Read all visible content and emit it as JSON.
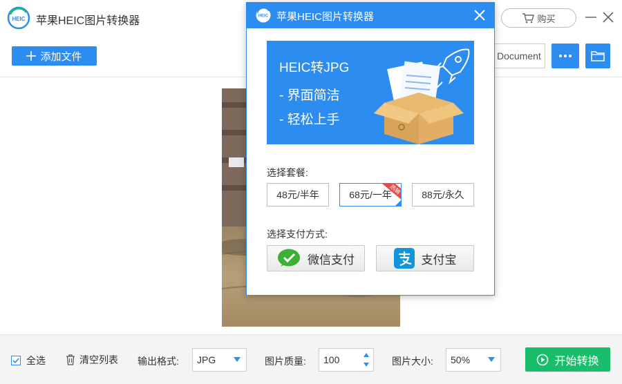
{
  "app": {
    "title": "苹果HEIC图片转换器",
    "logo_text": "HEIC",
    "buy_label": "购买"
  },
  "toolbar": {
    "add_file_label": "添加文件",
    "output_path": "Document"
  },
  "bottom": {
    "select_all_label": "全选",
    "select_all_checked": true,
    "clear_list_label": "清空列表",
    "output_format_label": "输出格式:",
    "output_format_value": "JPG",
    "quality_label": "图片质量:",
    "quality_value": "100",
    "size_label": "图片大小:",
    "size_value": "50%",
    "start_label": "开始转换"
  },
  "modal": {
    "title": "苹果HEIC图片转换器",
    "banner": {
      "line1": "HEIC转JPG",
      "line2": "- 界面简洁",
      "line3": "- 轻松上手"
    },
    "plan_label": "选择套餐:",
    "plans": [
      {
        "label": "48元/半年",
        "selected": false
      },
      {
        "label": "68元/一年",
        "selected": true,
        "badge": "热销"
      },
      {
        "label": "88元/永久",
        "selected": false
      }
    ],
    "payment_label": "选择支付方式:",
    "payments": {
      "wechat": "微信支付",
      "alipay": "支付宝"
    }
  },
  "colors": {
    "accent": "#2d8cf0",
    "start_button": "#19be6b",
    "wechat": "#3cb034",
    "alipay": "#1296db",
    "badge": "#e84a4a"
  }
}
